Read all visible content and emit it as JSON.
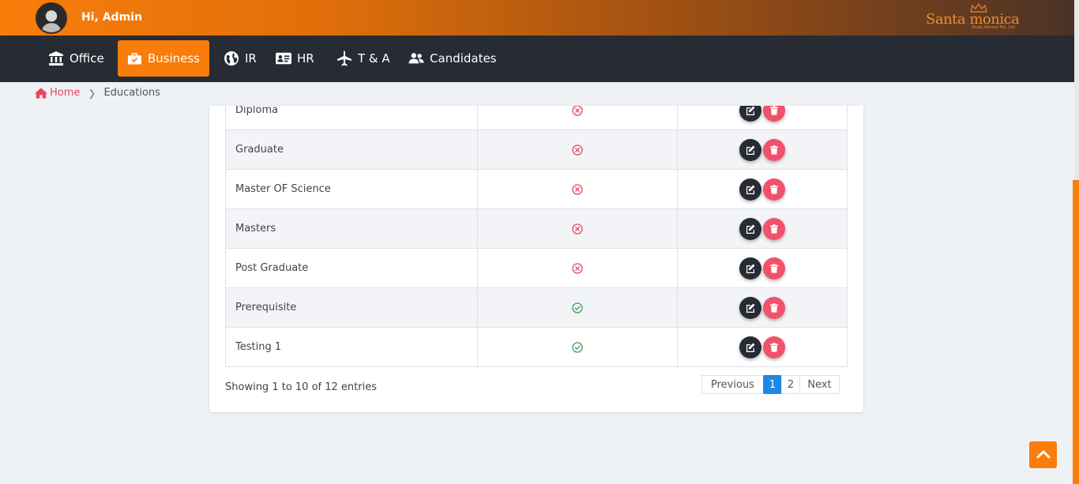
{
  "header": {
    "greeting": "Hi, Admin",
    "brand": {
      "name": "Santa monica",
      "tagline": "Study Abroad Pvt. Ltd."
    }
  },
  "nav": {
    "items": [
      {
        "label": "Office",
        "icon": "bank-icon",
        "active": false
      },
      {
        "label": "Business",
        "icon": "briefcase-icon",
        "active": true
      },
      {
        "label": "IR",
        "icon": "globe-icon",
        "active": false
      },
      {
        "label": "HR",
        "icon": "id-card-icon",
        "active": false
      },
      {
        "label": "T & A",
        "icon": "plane-icon",
        "active": false
      },
      {
        "label": "Candidates",
        "icon": "users-icon",
        "active": false
      }
    ]
  },
  "breadcrumb": {
    "home": "Home",
    "current": "Educations"
  },
  "table": {
    "rows": [
      {
        "name": "Diploma",
        "status": "inactive"
      },
      {
        "name": "Graduate",
        "status": "inactive"
      },
      {
        "name": "Master OF Science",
        "status": "inactive"
      },
      {
        "name": "Masters",
        "status": "inactive"
      },
      {
        "name": "Post Graduate",
        "status": "inactive"
      },
      {
        "name": "Prerequisite",
        "status": "active"
      },
      {
        "name": "Testing 1",
        "status": "active"
      }
    ]
  },
  "pagination": {
    "info": "Showing 1 to 10 of 12 entries",
    "previous": "Previous",
    "pages": [
      "1",
      "2"
    ],
    "current": "1",
    "next": "Next"
  },
  "colors": {
    "accent": "#f97d0b",
    "navbar": "#272b33",
    "inactive": "#e94560",
    "active": "#3a9a5b",
    "delete": "#f1516a",
    "page_active": "#1e88e5"
  }
}
